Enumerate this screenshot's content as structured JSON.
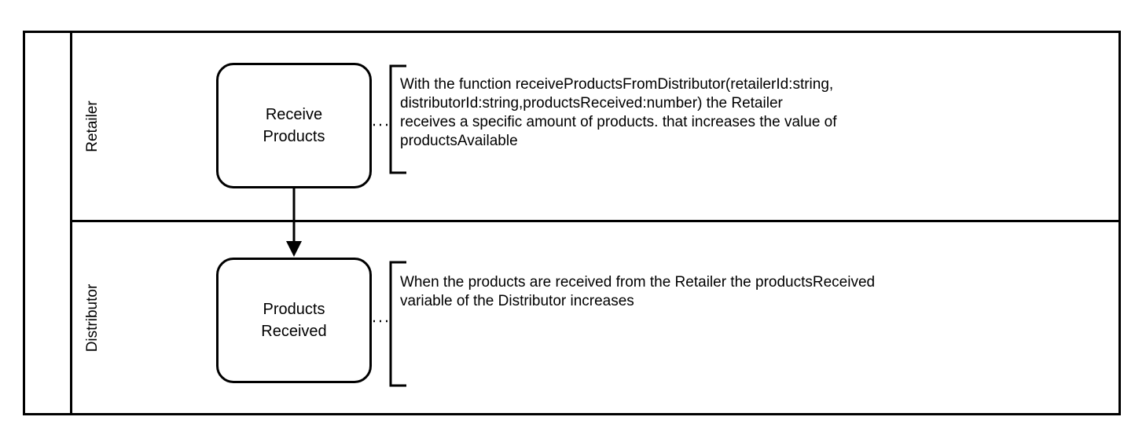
{
  "diagram": {
    "lanes": [
      {
        "id": "retailer",
        "label": "Retailer"
      },
      {
        "id": "distributor",
        "label": "Distributor"
      }
    ],
    "tasks": {
      "receive_products": "Receive\nProducts",
      "products_received": "Products\nReceived"
    },
    "annotations": {
      "receive_products": "With the function receiveProductsFromDistributor(retailerId:string,\ndistributorId:string,productsReceived:number) the Retailer\nreceives a specific amount of products. that increases the value of\nproductsAvailable",
      "products_received": "When the products are received from the Retailer the productsReceived\nvariable of the Distributor increases"
    }
  }
}
